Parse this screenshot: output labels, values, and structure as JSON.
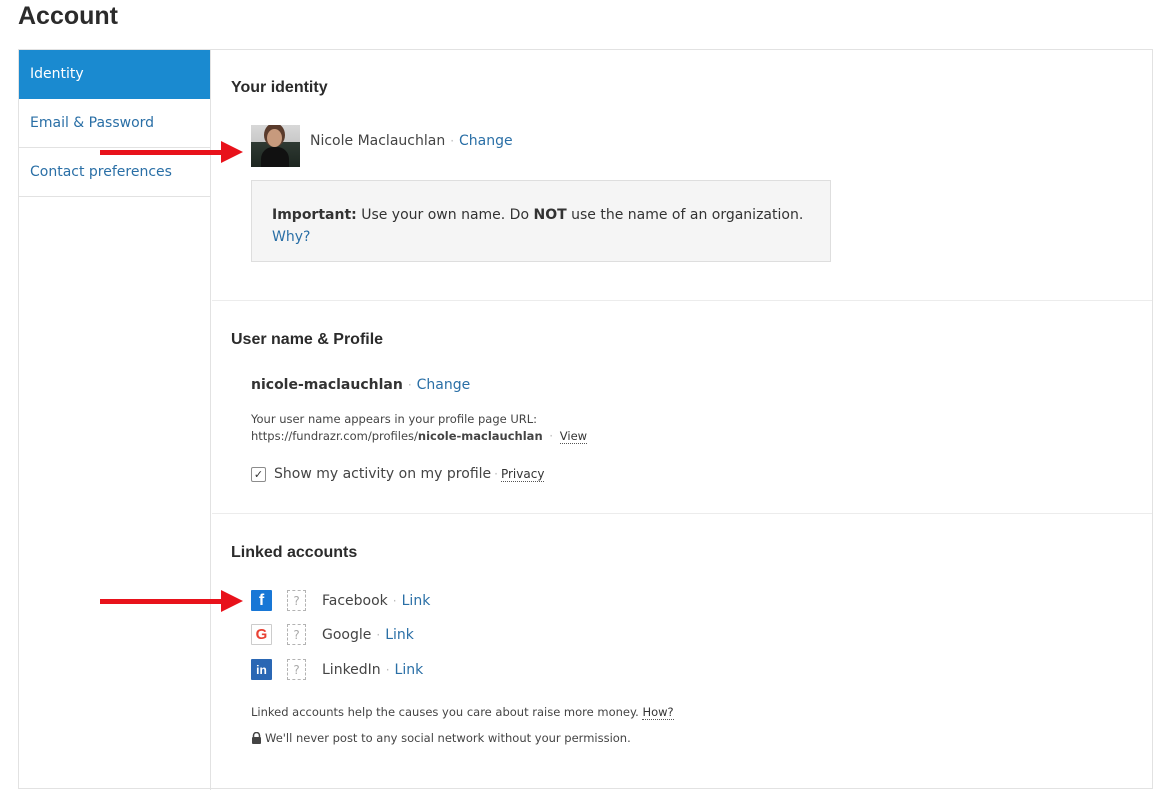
{
  "page": {
    "title": "Account"
  },
  "sidebar": {
    "items": [
      {
        "label": "Identity"
      },
      {
        "label": "Email & Password"
      },
      {
        "label": "Contact preferences"
      }
    ]
  },
  "identity": {
    "heading": "Your identity",
    "name": "Nicole Maclauchlan",
    "change_label": "Change",
    "notice_strong": "Important:",
    "notice_text_1": "Use your own name. Do",
    "notice_not": "NOT",
    "notice_text_2": "use the name of an organization.",
    "why_label": "Why?"
  },
  "profile": {
    "heading": "User name & Profile",
    "username": "nicole-maclauchlan",
    "change_label": "Change",
    "url_intro": "Your user name appears in your profile page URL:",
    "url_base": "https://fundrazr.com/profiles/",
    "url_user": "nicole-maclauchlan",
    "view_label": "View",
    "activity_checked": true,
    "activity_label": "Show my activity on my profile",
    "privacy_label": "Privacy"
  },
  "linked": {
    "heading": "Linked accounts",
    "accounts": [
      {
        "name": "Facebook",
        "link_label": "Link",
        "icon": "facebook-icon"
      },
      {
        "name": "Google",
        "link_label": "Link",
        "icon": "google-icon"
      },
      {
        "name": "LinkedIn",
        "link_label": "Link",
        "icon": "linkedin-icon"
      }
    ],
    "help_text": "Linked accounts help the causes you care about raise more money.",
    "how_label": "How?",
    "privacy_note": "We'll never post to any social network without your permission."
  },
  "colors": {
    "accent": "#1a8ad0",
    "link": "#2a6fa6",
    "arrow": "#e8121b"
  }
}
